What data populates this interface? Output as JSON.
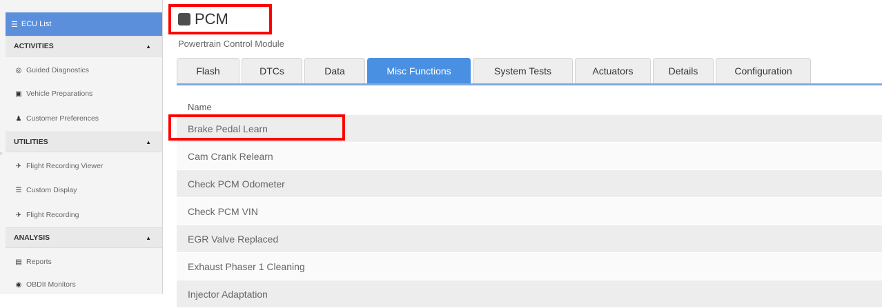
{
  "sidebar": {
    "top_item": {
      "label": "ECU List",
      "icon": "list-icon"
    },
    "sections": [
      {
        "title": "ACTIVITIES",
        "items": [
          {
            "label": "Guided Diagnostics",
            "icon": "target-icon"
          },
          {
            "label": "Vehicle Preparations",
            "icon": "car-icon"
          },
          {
            "label": "Customer Preferences",
            "icon": "user-prefs-icon"
          }
        ]
      },
      {
        "title": "UTILITIES",
        "items": [
          {
            "label": "Flight Recording Viewer",
            "icon": "plane-icon"
          },
          {
            "label": "Custom Display",
            "icon": "list-lines-icon"
          },
          {
            "label": "Flight Recording",
            "icon": "plane-icon"
          }
        ]
      },
      {
        "title": "ANALYSIS",
        "items": [
          {
            "label": "Reports",
            "icon": "report-icon"
          },
          {
            "label": "OBDII Monitors",
            "icon": "gauge-icon"
          }
        ]
      }
    ],
    "caret": "▲"
  },
  "module": {
    "title": "PCM",
    "subtitle": "Powertrain Control Module"
  },
  "tabs": [
    {
      "label": "Flash"
    },
    {
      "label": "DTCs"
    },
    {
      "label": "Data"
    },
    {
      "label": "Misc Functions",
      "active": true
    },
    {
      "label": "System Tests"
    },
    {
      "label": "Actuators"
    },
    {
      "label": "Details"
    },
    {
      "label": "Configuration"
    }
  ],
  "table": {
    "header": "Name",
    "rows": [
      "Brake Pedal Learn",
      "Cam Crank Relearn",
      "Check PCM Odometer",
      "Check PCM VIN",
      "EGR Valve Replaced",
      "Exhaust Phaser 1 Cleaning",
      "Injector Adaptation"
    ]
  },
  "colors": {
    "accent": "#4a90e2",
    "sidebar_active": "#5b8fdc",
    "highlight": "#ff0000"
  }
}
